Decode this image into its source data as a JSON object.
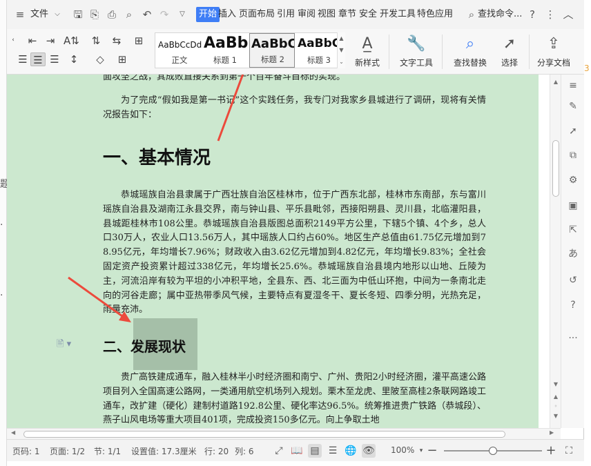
{
  "background": {
    "left_glyphs": [
      "题",
      "·",
      "·"
    ],
    "right_glyph": "3"
  },
  "menubar": {
    "file_label": "文件",
    "tabs": [
      "开始",
      "插入",
      "页面布局",
      "引用",
      "审阅",
      "视图",
      "章节",
      "安全",
      "开发工具",
      "特色应用"
    ],
    "search_label": "查找命令..."
  },
  "ribbon": {
    "styles": [
      {
        "sample": "AaBbCcDd",
        "name": "正文"
      },
      {
        "sample": "AaBb",
        "name": "标题 1"
      },
      {
        "sample": "AaBbC",
        "name": "标题 2"
      },
      {
        "sample": "AaBbC",
        "name": "标题 3"
      }
    ],
    "new_style_label": "新样式",
    "text_tools_label": "文字工具",
    "find_replace_label": "查找替换",
    "select_label": "选择",
    "share_label": "分享文档"
  },
  "document": {
    "paragraphs": [
      "面攻坚之战，其成败直接关系到第一个百年奋斗目标的实现。",
      "为了完成“假如我是第一书记”这个实践任务，我专门对我家乡县城进行了调研，现将有关情况报告如下：",
      "恭城瑶族自治县隶属于广西壮族自治区桂林市，位于广西东北部，桂林市东南部，东与富川瑶族自治县及湖南江永县交界，南与钟山县、平乐县毗邻，西接阳朔县、灵川县，北临灌阳县，县城距桂林市108公里。恭城瑶族自治县版图总面积2149平方公里，下辖5个镇、4个乡，总人口30万人，农业人口13.56万人，其中瑶族人口约占60%。地区生产总值由61.75亿元增加到78.95亿元，年均增长7.96%；财政收入由3.62亿元增加到4.82亿元，年均增长9.83%；全社会固定资产投资累计超过338亿元，年均增长25.6%。恭城瑶族自治县境内地形以山地、丘陵为主，河流沿岸有较为平坦的小冲积平地，全县东、西、北三面为中低山环抱，中间为一条南北走向的河谷走廊；属中亚热带季风气候，主要特点有夏湿冬干、夏长冬短、四季分明，光热充足，雨量充沛。",
      "贵广高铁建成通车，融入桂林半小时经济圈和南宁、广州、贵阳2小时经济圈，灌平高速公路项目列入全国高速公路网，一类通用航空机场列入规划。栗木至龙虎、里陂至高桂2条联网路竣工通车，改扩建（硬化）建制村道路192.8公里、硬化率达96.5%。统筹推进贵广铁路（恭城段）、燕子山风电场等重大项目401项，完成投资150多亿元。向上争取土地"
    ],
    "heading1": "一、基本情况",
    "heading2": "二、发展现状"
  },
  "statusbar": {
    "page_code": "页码: 1",
    "page": "页面: 1/2",
    "section": "节: 1/1",
    "setting": "设置值: 17.3厘米",
    "row": "行: 20",
    "col": "列: 6",
    "zoom": "100%",
    "zoom_level": 0.5
  },
  "colors": {
    "accent": "#3f7ef6",
    "page_background": "#cce8cf",
    "annotation_arrow": "#ec4a3c"
  }
}
